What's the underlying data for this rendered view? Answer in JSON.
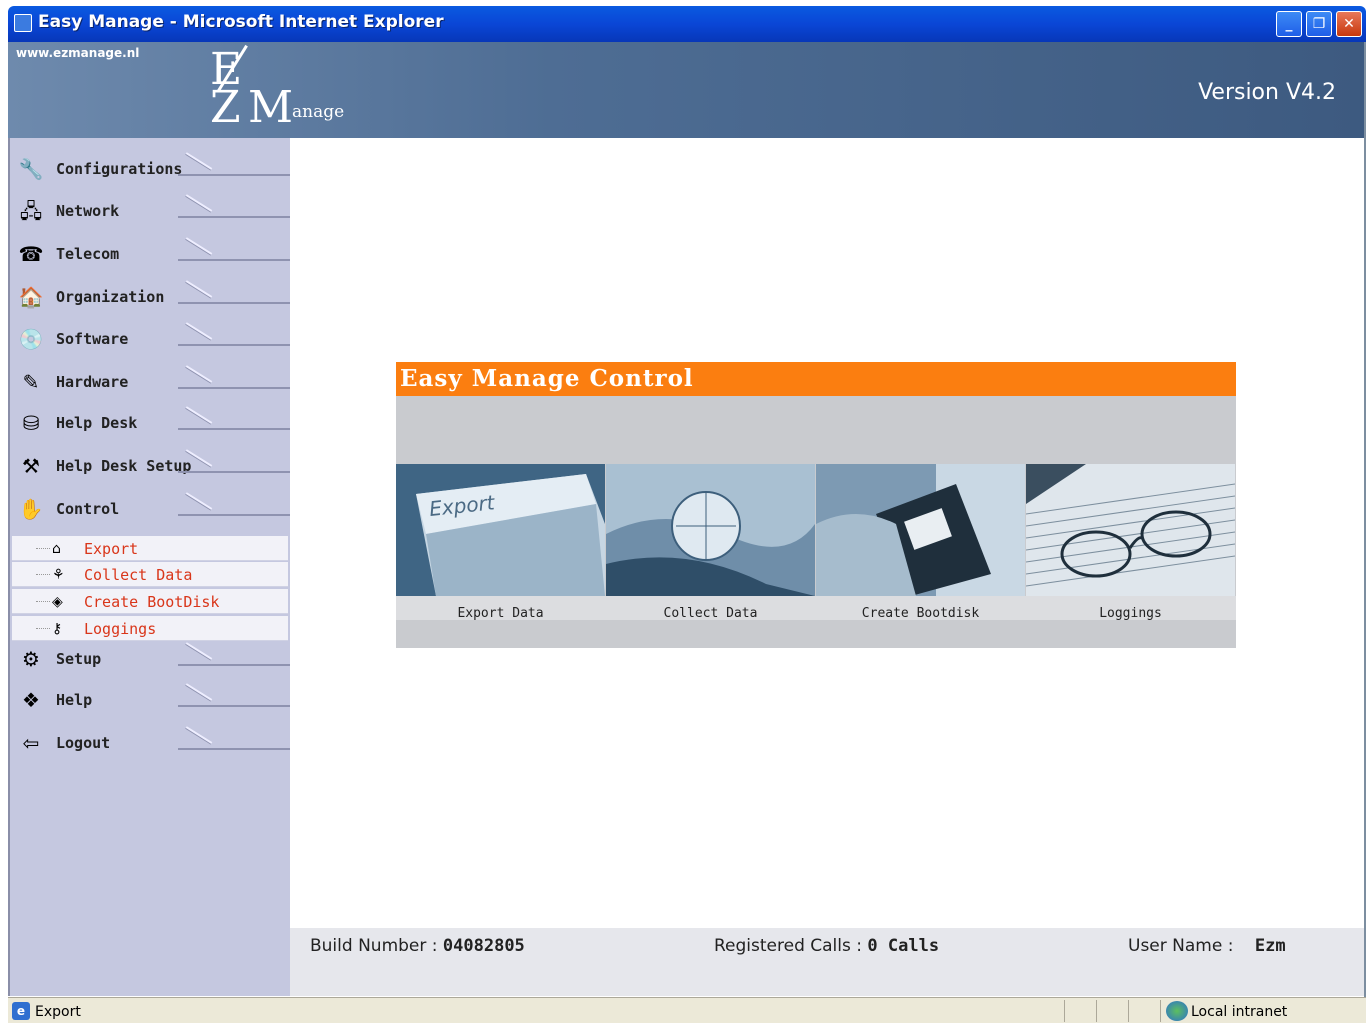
{
  "window": {
    "title": "Easy Manage - Microsoft Internet Explorer",
    "controls": {
      "minimize": "_",
      "restore": "❐",
      "close": "✕"
    }
  },
  "header": {
    "url": "www.ezmanage.nl",
    "logo": {
      "e": "E",
      "z": "Z",
      "m": "M",
      "anage": "anage"
    },
    "version": "Version V4.2"
  },
  "sidebar": {
    "items": [
      {
        "label": "Configurations",
        "icon": "configurations-icon",
        "glyph": "🔧"
      },
      {
        "label": "Network",
        "icon": "network-icon",
        "glyph": "🖧"
      },
      {
        "label": "Telecom",
        "icon": "telecom-icon",
        "glyph": "☎"
      },
      {
        "label": "Organization",
        "icon": "organization-icon",
        "glyph": "🏠"
      },
      {
        "label": "Software",
        "icon": "software-icon",
        "glyph": "💿"
      },
      {
        "label": "Hardware",
        "icon": "hardware-icon",
        "glyph": "✎"
      },
      {
        "label": "Help Desk",
        "icon": "help-desk-icon",
        "glyph": "⛁"
      },
      {
        "label": "Help Desk Setup",
        "icon": "help-desk-setup-icon",
        "glyph": "⚒"
      },
      {
        "label": "Control",
        "icon": "control-icon",
        "glyph": "✋"
      },
      {
        "label": "Setup",
        "icon": "setup-icon",
        "glyph": "⚙"
      },
      {
        "label": "Help",
        "icon": "help-icon",
        "glyph": "❖"
      },
      {
        "label": "Logout",
        "icon": "logout-icon",
        "glyph": "⇦"
      }
    ],
    "control_submenu": [
      {
        "label": "Export",
        "icon": "export-icon",
        "glyph": "⌂"
      },
      {
        "label": "Collect Data",
        "icon": "collect-data-icon",
        "glyph": "⚘"
      },
      {
        "label": "Create BootDisk",
        "icon": "create-bootdisk-icon",
        "glyph": "◈"
      },
      {
        "label": "Loggings",
        "icon": "loggings-icon",
        "glyph": "⚷"
      }
    ]
  },
  "panel": {
    "title": "Easy Manage Control",
    "tiles": [
      {
        "label": "Export Data",
        "image_text": "Export"
      },
      {
        "label": "Collect Data"
      },
      {
        "label": "Create Bootdisk"
      },
      {
        "label": "Loggings"
      }
    ]
  },
  "info": {
    "build_label": "Build Number :",
    "build_value": "04082805",
    "calls_label": "Registered Calls :",
    "calls_value": "0 Calls",
    "user_label": "User Name :",
    "user_value": "Ezm"
  },
  "status": {
    "text": "Export",
    "zone": "Local intranet"
  },
  "colors": {
    "accent": "#fb7e10",
    "sidebar_bg": "#c5c8e0",
    "submenu_text": "#d9361a",
    "header_bg": "#4e6d94"
  }
}
